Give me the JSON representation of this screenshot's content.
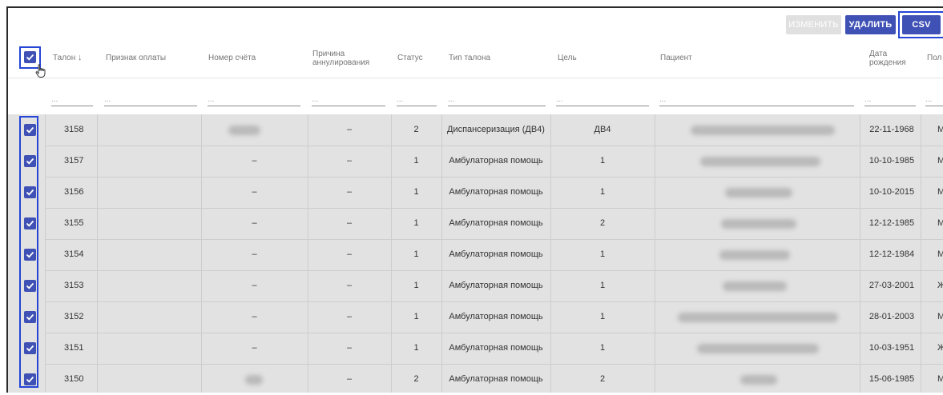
{
  "toolbar": {
    "edit_label": "ИЗМЕНИТЬ",
    "delete_label": "УДАЛИТЬ",
    "csv_label": "CSV"
  },
  "columns": {
    "talon": "Талон",
    "payment_sign": "Признак оплаты",
    "invoice_number": "Номер счёта",
    "cancel_reason_1": "Причина",
    "cancel_reason_2": "аннулирования",
    "status": "Статус",
    "talon_type": "Тип талона",
    "goal": "Цель",
    "patient": "Пациент",
    "birth_date_1": "Дата",
    "birth_date_2": "рождения",
    "sex": "Пол"
  },
  "filter_placeholder": "...",
  "rows": [
    {
      "talon": "3158",
      "invoice": "",
      "reason": "–",
      "status": "2",
      "type": "Диспансеризация (ДВ4)",
      "goal": "ДВ4",
      "birth": "22-11-1968",
      "sex": "М"
    },
    {
      "talon": "3157",
      "invoice": "–",
      "reason": "–",
      "status": "1",
      "type": "Амбулаторная помощь",
      "goal": "1",
      "birth": "10-10-1985",
      "sex": "М"
    },
    {
      "talon": "3156",
      "invoice": "–",
      "reason": "–",
      "status": "1",
      "type": "Амбулаторная помощь",
      "goal": "1",
      "birth": "10-10-2015",
      "sex": "М"
    },
    {
      "talon": "3155",
      "invoice": "–",
      "reason": "–",
      "status": "1",
      "type": "Амбулаторная помощь",
      "goal": "2",
      "birth": "12-12-1985",
      "sex": "М"
    },
    {
      "talon": "3154",
      "invoice": "–",
      "reason": "–",
      "status": "1",
      "type": "Амбулаторная помощь",
      "goal": "1",
      "birth": "12-12-1984",
      "sex": "М"
    },
    {
      "talon": "3153",
      "invoice": "–",
      "reason": "–",
      "status": "1",
      "type": "Амбулаторная помощь",
      "goal": "1",
      "birth": "27-03-2001",
      "sex": "Ж"
    },
    {
      "talon": "3152",
      "invoice": "–",
      "reason": "–",
      "status": "1",
      "type": "Амбулаторная помощь",
      "goal": "1",
      "birth": "28-01-2003",
      "sex": "М"
    },
    {
      "talon": "3151",
      "invoice": "–",
      "reason": "–",
      "status": "1",
      "type": "Амбулаторная помощь",
      "goal": "1",
      "birth": "10-03-1951",
      "sex": "Ж"
    },
    {
      "talon": "3150",
      "invoice": "",
      "reason": "–",
      "status": "2",
      "type": "Амбулаторная помощь",
      "goal": "2",
      "birth": "15-06-1985",
      "sex": "М"
    }
  ],
  "colors": {
    "accent": "#3f51b5",
    "highlight": "#2545d6",
    "row_bg": "#e2e2e2"
  },
  "icons": {
    "sort": "arrow-down-icon",
    "checkbox": "checkbox-checked-icon",
    "cursor": "hand-pointer-icon"
  }
}
